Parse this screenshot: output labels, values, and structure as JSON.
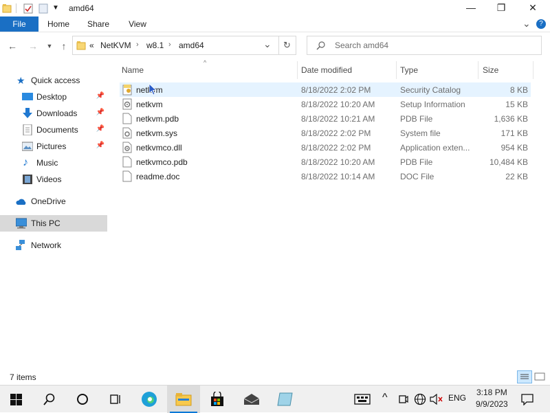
{
  "window": {
    "title": "amd64",
    "minimize": "—",
    "maximize": "❐",
    "close": "✕"
  },
  "ribbon": {
    "file": "File",
    "home": "Home",
    "share": "Share",
    "view": "View",
    "expand": "⌄",
    "help": "?"
  },
  "address": {
    "overflow": "«",
    "crumbs": [
      "NetKVM",
      "w8.1",
      "amd64"
    ],
    "sep": "›",
    "dropdown": "⌄",
    "refresh": "↻"
  },
  "search": {
    "placeholder": "Search amd64"
  },
  "nav": {
    "quick_access": "Quick access",
    "desktop": "Desktop",
    "downloads": "Downloads",
    "documents": "Documents",
    "pictures": "Pictures",
    "music": "Music",
    "videos": "Videos",
    "onedrive": "OneDrive",
    "this_pc": "This PC",
    "network": "Network"
  },
  "columns": {
    "name": "Name",
    "date": "Date modified",
    "type": "Type",
    "size": "Size"
  },
  "files": [
    {
      "name": "netkvm",
      "date": "8/18/2022 2:02 PM",
      "type": "Security Catalog",
      "size": "8 KB"
    },
    {
      "name": "netkvm",
      "date": "8/18/2022 10:20 AM",
      "type": "Setup Information",
      "size": "15 KB"
    },
    {
      "name": "netkvm.pdb",
      "date": "8/18/2022 10:21 AM",
      "type": "PDB File",
      "size": "1,636 KB"
    },
    {
      "name": "netkvm.sys",
      "date": "8/18/2022 2:02 PM",
      "type": "System file",
      "size": "171 KB"
    },
    {
      "name": "netkvmco.dll",
      "date": "8/18/2022 2:02 PM",
      "type": "Application exten...",
      "size": "954 KB"
    },
    {
      "name": "netkvmco.pdb",
      "date": "8/18/2022 10:20 AM",
      "type": "PDB File",
      "size": "10,484 KB"
    },
    {
      "name": "readme.doc",
      "date": "8/18/2022 10:14 AM",
      "type": "DOC File",
      "size": "22 KB"
    }
  ],
  "status": {
    "count": "7 items"
  },
  "taskbar": {
    "lang": "ENG",
    "time": "3:18 PM",
    "date": "9/9/2023"
  },
  "colors": {
    "accent": "#1a6fc4",
    "selection": "#e5f3ff",
    "nav_selected": "#d9d9d9"
  }
}
